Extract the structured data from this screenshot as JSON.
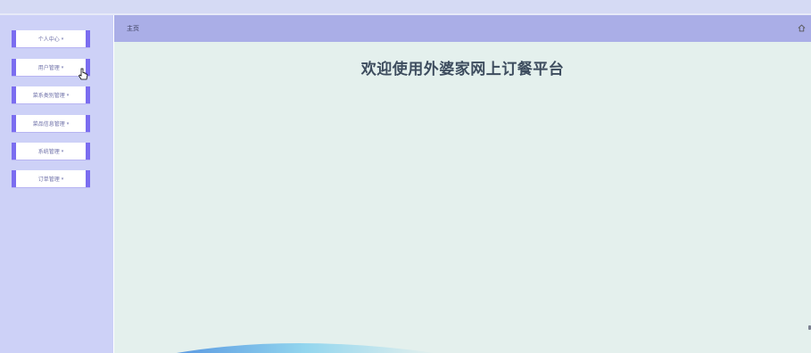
{
  "sidebar": {
    "items": [
      {
        "label": "个人中心"
      },
      {
        "label": "用户管理"
      },
      {
        "label": "菜系类别管理"
      },
      {
        "label": "菜品信息管理"
      },
      {
        "label": "系统管理"
      },
      {
        "label": "订单管理"
      }
    ],
    "caret": "▾"
  },
  "header": {
    "breadcrumb": "主页"
  },
  "main": {
    "welcome": "欢迎使用外婆家网上订餐平台"
  },
  "colors": {
    "menu_border": "#7b6df0",
    "header_bar": "#aaaee7",
    "sidebar_bg": "#cdd1f7",
    "content_bg": "#e4f0ed"
  },
  "icons": [
    "home-icon",
    "pointer-cursor-icon"
  ]
}
